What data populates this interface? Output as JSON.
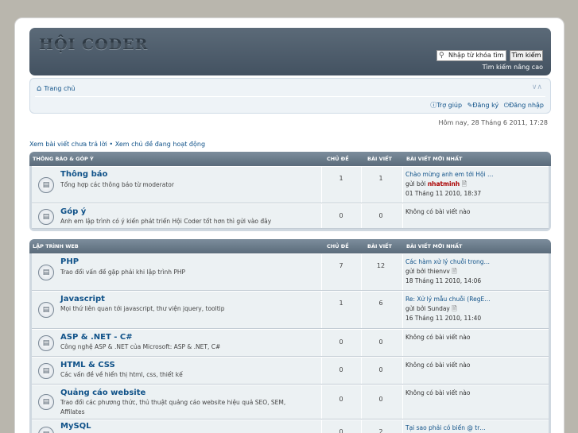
{
  "header": {
    "logo_text": "HỘI CODER",
    "search_placeholder": "Nhập từ khóa tìm k",
    "search_button": "Tìm kiếm",
    "advanced_search": "Tìm kiếm nâng cao"
  },
  "nav": {
    "home": "Trang chủ",
    "help": "Trợ giúp",
    "register": "Đăng ký",
    "login": "Đăng nhập"
  },
  "timestamp": "Hôm nay, 28 Tháng 6 2011, 17:28",
  "quick_links": {
    "unanswered": "Xem bài viết chưa trả lời",
    "separator": " • ",
    "active": "Xem chủ đề đang hoạt động"
  },
  "categories": [
    {
      "name": "THÔNG BÁO & GÓP Ý",
      "col_topics": "CHỦ ĐỀ",
      "col_posts": "BÀI VIẾT",
      "col_last": "BÀI VIẾT MỚI NHẤT",
      "forums": [
        {
          "title": "Thông báo",
          "desc": "Tổng hợp các thông báo từ moderator",
          "topics": "1",
          "posts": "1",
          "last_title": "Chào mừng anh em tới Hội …",
          "last_by": "gửi bởi",
          "last_author": "nhatminh",
          "last_time": "01 Tháng 11 2010, 18:37"
        },
        {
          "title": "Góp ý",
          "desc": "Anh em lập trình có ý kiến phát triển Hội Coder tốt hơn thì gửi vào đây",
          "topics": "0",
          "posts": "0",
          "last_title": "Không có bài viết nào",
          "last_by": "",
          "last_author": "",
          "last_time": ""
        }
      ]
    },
    {
      "name": "LẬP TRÌNH WEB",
      "col_topics": "CHỦ ĐỀ",
      "col_posts": "BÀI VIẾT",
      "col_last": "BÀI VIẾT MỚI NHẤT",
      "forums": [
        {
          "title": "PHP",
          "desc": "Trao đổi vấn đề gặp phải khi lập trình PHP",
          "topics": "7",
          "posts": "12",
          "last_title": "Các hàm xử lý chuỗi trong…",
          "last_by": "gửi bởi",
          "last_author": "thienvv",
          "last_time": "18 Tháng 11 2010, 14:06"
        },
        {
          "title": "Javascript",
          "desc": "Mọi thứ liên quan tới javascript, thư viện jquery, tooltip",
          "topics": "1",
          "posts": "6",
          "last_title": "Re: Xử lý mẫu chuỗi (RegE…",
          "last_by": "gửi bởi",
          "last_author": "Sunday",
          "last_time": "16 Tháng 11 2010, 11:40"
        },
        {
          "title": "ASP & .NET - C#",
          "desc": "Công nghệ ASP & .NET của Microsoft: ASP & .NET, C#",
          "topics": "0",
          "posts": "0",
          "last_title": "Không có bài viết nào",
          "last_by": "",
          "last_author": "",
          "last_time": ""
        },
        {
          "title": "HTML & CSS",
          "desc": "Các vấn đề về hiển thị html, css, thiết kế",
          "topics": "0",
          "posts": "0",
          "last_title": "Không có bài viết nào",
          "last_by": "",
          "last_author": "",
          "last_time": ""
        },
        {
          "title": "Quảng cáo website",
          "desc": "Trao đổi các phương thức, thủ thuật quảng cáo website hiệu quả SEO, SEM, Affilates",
          "topics": "0",
          "posts": "0",
          "last_title": "Không có bài viết nào",
          "last_by": "",
          "last_author": "",
          "last_time": ""
        },
        {
          "title": "MySQL",
          "desc": "",
          "topics": "0",
          "posts": "2",
          "last_title": "Tại sao phải có biến @ tr…",
          "last_by": "",
          "last_author": "",
          "last_time": ""
        }
      ]
    }
  ]
}
